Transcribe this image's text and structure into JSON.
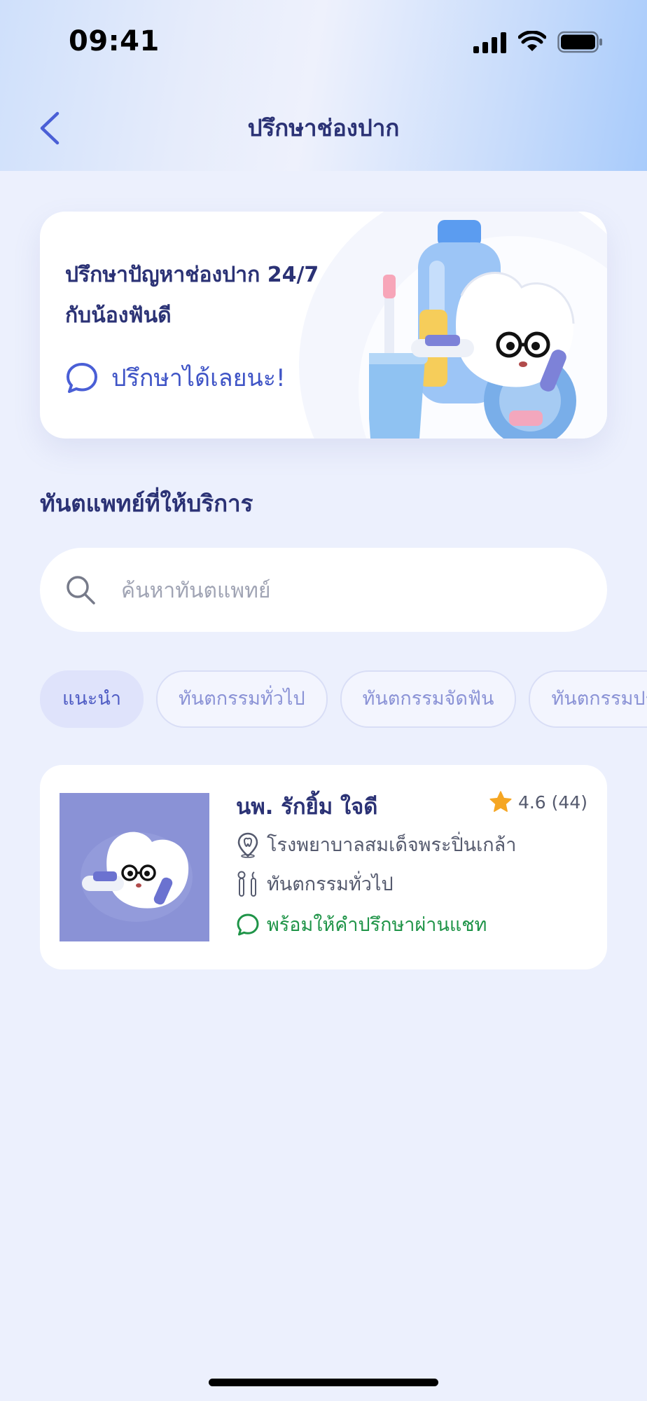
{
  "status_bar": {
    "time": "09:41"
  },
  "header": {
    "title": "ปรึกษาช่องปาก"
  },
  "promo": {
    "title_line1": "ปรึกษาปัญหาช่องปาก 24/7",
    "title_line2": "กับน้องฟันดี",
    "cta_label": "ปรึกษาได้เลยนะ!"
  },
  "section": {
    "title": "ทันตแพทย์ที่ให้บริการ"
  },
  "search": {
    "placeholder": "ค้นหาทันตแพทย์",
    "value": ""
  },
  "filters": [
    {
      "label": "แนะนำ",
      "active": true
    },
    {
      "label": "ทันตกรรมทั่วไป",
      "active": false
    },
    {
      "label": "ทันตกรรมจัดฟัน",
      "active": false
    },
    {
      "label": "ทันตกรรมประดิษฐ์",
      "active": false
    }
  ],
  "doctors": [
    {
      "name": "นพ. รักยิ้ม ใจดี",
      "rating": "4.6",
      "reviews": "(44)",
      "hospital": "โรงพยาบาลสมเด็จพระปิ่นเกล้า",
      "specialty": "ทันตกรรมทั่วไป",
      "availability": "พร้อมให้คำปรึกษาผ่านแชท"
    }
  ],
  "colors": {
    "primary": "#3f54c6",
    "title": "#2b3275",
    "available": "#1f9448",
    "star": "#f5a623",
    "background": "#ecf0fd"
  },
  "icons": {
    "back": "chevron-left-icon",
    "chat": "chat-bubble-icon",
    "search": "search-icon",
    "star": "star-icon",
    "hospital": "location-pin-icon",
    "specialty": "dental-tools-icon",
    "signal": "cellular-signal-icon",
    "wifi": "wifi-icon",
    "battery": "battery-icon"
  }
}
